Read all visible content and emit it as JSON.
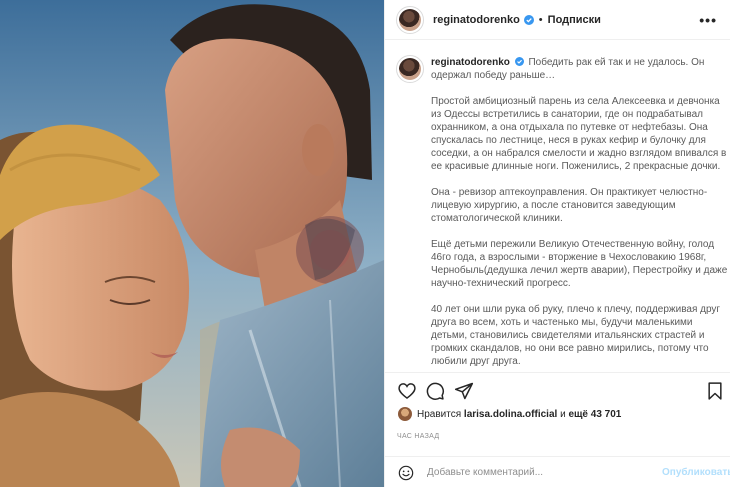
{
  "post": {
    "username": "reginatodorenko",
    "dot": "•",
    "follow_label": "Подписки",
    "more_label": "•••"
  },
  "caption": {
    "username": "reginatodorenko",
    "lines": [
      [
        "Победить рак ей так и не удалось. Он"
      ],
      [
        "одержал победу раньше…"
      ],
      [],
      [
        "Простой амбициозный парень из села Алексеевка и девчонка"
      ],
      [
        "из Одессы встретились в санатории, где он подрабатывал"
      ],
      [
        "охранником, а она отдыхала по путевке от нефтебазы. Она"
      ],
      [
        "спускалась по лестнице, неся в руках кефир и булочку для"
      ],
      [
        "соседки, а он набрался смелости и жадно взглядом впивался в"
      ],
      [
        "ее красивые длинные ноги. Поженились, 2 прекрасные дочки."
      ],
      [],
      [
        "Она - ревизор аптекоуправления. Он практикует челюстно-"
      ],
      [
        "лицевую хирургию, а после становится заведующим"
      ],
      [
        "стоматологической клиники."
      ],
      [],
      [
        "Ещё детьми пережили Великую Отечественную войну, голод"
      ],
      [
        "46го года, а взрослыми - вторжение в Чехословакию 1968г,"
      ],
      [
        "Чернобыль(дедушка лечил жертв аварии), Перестройку и даже"
      ],
      [
        "научно-технический прогресс."
      ],
      [],
      [
        "40 лет они шли рука об руку, плечо к плечу, поддерживая друг"
      ],
      [
        "друга во всем, хоть и частенько мы, будучи маленькими"
      ],
      [
        "детьми, становились свидетелями итальянских страстей и"
      ],
      [
        "громких скандалов, но они все равно мирились, потому что"
      ],
      [
        "любили друг друга."
      ]
    ]
  },
  "likes": {
    "prefix": "Нравится",
    "user": "larisa.dolina.official",
    "middle": "и",
    "others": "ещё 43 701"
  },
  "timestamp": "ЧАС НАЗАД",
  "comment": {
    "placeholder": "Добавьте комментарий...",
    "post_label": "Опубликовать"
  },
  "colors": {
    "verified": "#3897f0",
    "post_button": "#b2dffc",
    "muted": "#8e8e8e"
  },
  "icons": {
    "like": "heart-icon",
    "comment": "comment-icon",
    "share": "paper-plane-icon",
    "save": "bookmark-icon",
    "emoji": "smiley-icon",
    "verified": "verified-badge-icon",
    "more": "more-options-icon"
  }
}
